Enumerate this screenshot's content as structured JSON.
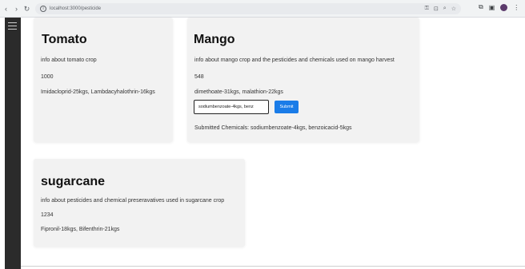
{
  "browser": {
    "url": "localhost:3000/pesticide",
    "back": "‹",
    "forward": "›",
    "reload": "↻"
  },
  "sidebar": {
    "menu_icon": "hamburger-icon"
  },
  "cards": {
    "tomato": {
      "title": "Tomato",
      "description": "info about tomato crop",
      "value": "1000",
      "chemicals": "Imidacloprid-25kgs, Lambdacyhalothrin-16kgs"
    },
    "mango": {
      "title": "Mango",
      "description": "info about mango crop and the pesticides and chemicals used on mango harvest",
      "value": "548",
      "chemicals": "dimethoate-31kgs, malathion-22kgs",
      "input_value": "sodiumbenzoate-4kgs, benz",
      "submit_label": "Submit",
      "submitted": "Submitted Chemicals: sodiumbenzoate-4kgs, benzoicacid-5kgs"
    },
    "sugarcane": {
      "title": "sugarcane",
      "description": "info about pesticides and chemical preseravatives used in sugarcane crop",
      "value": "1234",
      "chemicals": "Fipronil-18kgs, Bifenthrin-21kgs"
    }
  },
  "colors": {
    "accent": "#1a7ce8",
    "card_bg": "#f2f2f2",
    "sidebar_bg": "#2b2b2b"
  }
}
